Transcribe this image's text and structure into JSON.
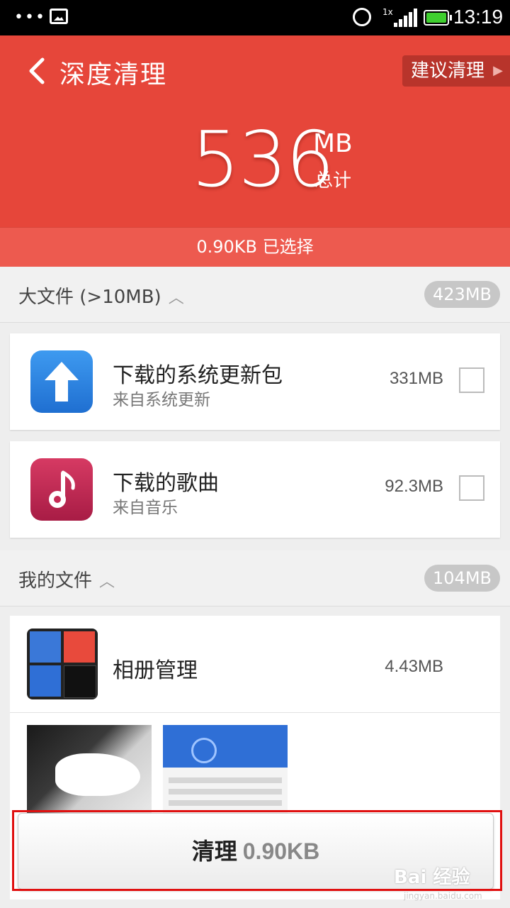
{
  "status_bar": {
    "dots": "•••",
    "network": "1x",
    "time": "13:19"
  },
  "header": {
    "title": "深度清理",
    "suggest_label": "建议清理",
    "total_value": "536",
    "total_unit": "MB",
    "total_label": "总计",
    "selected_text": "0.90KB  已选择"
  },
  "sections": [
    {
      "label": "大文件 (>10MB)",
      "size": "423MB",
      "items": [
        {
          "title": "下载的系统更新包",
          "subtitle": "来自系统更新",
          "size": "331MB",
          "icon": "upload-arrow-icon",
          "checked": false
        },
        {
          "title": "下载的歌曲",
          "subtitle": "来自音乐",
          "size": "92.3MB",
          "icon": "music-note-icon",
          "checked": false
        }
      ]
    },
    {
      "label": "我的文件",
      "size": "104MB",
      "items": [
        {
          "title": "相册管理",
          "size": "4.43MB",
          "icon": "album-thumbnail-icon"
        }
      ]
    }
  ],
  "clean_button": {
    "verb": "清理",
    "amount": "0.90KB"
  },
  "watermark": {
    "text": "Bai 经验",
    "sub": "jingyan.baidu.com"
  },
  "colors": {
    "header_red": "#e6463a",
    "selected_bar": "#ed5a4f",
    "highlight": "#e01010"
  }
}
